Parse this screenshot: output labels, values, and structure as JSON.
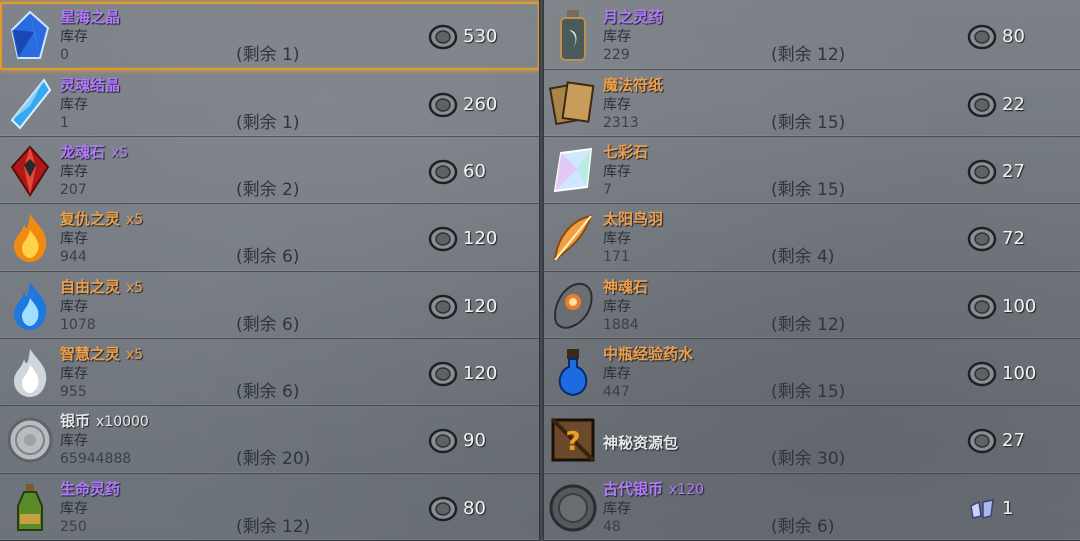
{
  "shop": {
    "labels": {
      "stock": "库存",
      "remain_prefix": "(剩余 ",
      "remain_suffix": ")"
    },
    "left_items": [
      {
        "name": "星海之晶",
        "qty": "",
        "color": "purple",
        "stock": "0",
        "remain": "(剩余 1)",
        "price": "530",
        "icon": "star-crystal-icon",
        "selected": true
      },
      {
        "name": "灵魂结晶",
        "qty": "",
        "color": "purple",
        "stock": "1",
        "remain": "(剩余 1)",
        "price": "260",
        "icon": "soul-crystal-icon",
        "selected": false
      },
      {
        "name": "龙魂石",
        "qty": "x5",
        "color": "purple",
        "stock": "207",
        "remain": "(剩余 2)",
        "price": "60",
        "icon": "dragon-soul-stone-icon",
        "selected": false
      },
      {
        "name": "复仇之灵",
        "qty": "x5",
        "color": "orange",
        "stock": "944",
        "remain": "(剩余 6)",
        "price": "120",
        "icon": "fire-spirit-icon",
        "selected": false
      },
      {
        "name": "自由之灵",
        "qty": "x5",
        "color": "orange",
        "stock": "1078",
        "remain": "(剩余 6)",
        "price": "120",
        "icon": "blue-spirit-icon",
        "selected": false
      },
      {
        "name": "智慧之灵",
        "qty": "x5",
        "color": "orange",
        "stock": "955",
        "remain": "(剩余 6)",
        "price": "120",
        "icon": "white-spirit-icon",
        "selected": false
      },
      {
        "name": "银币",
        "qty": "x10000",
        "color": "white",
        "stock": "65944888",
        "remain": "(剩余 20)",
        "price": "90",
        "icon": "silver-coin-icon",
        "selected": false
      },
      {
        "name": "生命灵药",
        "qty": "",
        "color": "purple",
        "stock": "250",
        "remain": "(剩余 12)",
        "price": "80",
        "icon": "life-potion-icon",
        "selected": false
      }
    ],
    "right_items": [
      {
        "name": "月之灵药",
        "qty": "",
        "color": "purple",
        "stock": "229",
        "remain": "(剩余 12)",
        "price": "80",
        "icon": "moon-potion-icon",
        "selected": false
      },
      {
        "name": "魔法符纸",
        "qty": "",
        "color": "orange",
        "stock": "2313",
        "remain": "(剩余 15)",
        "price": "22",
        "icon": "magic-paper-icon",
        "selected": false
      },
      {
        "name": "七彩石",
        "qty": "",
        "color": "orange",
        "stock": "7",
        "remain": "(剩余 15)",
        "price": "27",
        "icon": "rainbow-stone-icon",
        "selected": false
      },
      {
        "name": "太阳鸟羽",
        "qty": "",
        "color": "orange",
        "stock": "171",
        "remain": "(剩余 4)",
        "price": "72",
        "icon": "sunbird-feather-icon",
        "selected": false
      },
      {
        "name": "神魂石",
        "qty": "",
        "color": "orange",
        "stock": "1884",
        "remain": "(剩余 12)",
        "price": "100",
        "icon": "god-soul-stone-icon",
        "selected": false
      },
      {
        "name": "中瓶经验药水",
        "qty": "",
        "color": "orange",
        "stock": "447",
        "remain": "(剩余 15)",
        "price": "100",
        "icon": "exp-potion-icon",
        "selected": false
      },
      {
        "name": "神秘资源包",
        "qty": "",
        "color": "white",
        "stock": "",
        "remain": "(剩余 30)",
        "price": "27",
        "icon": "mystery-crate-icon",
        "selected": false,
        "no_stock": true
      },
      {
        "name": "古代银币",
        "qty": "x120",
        "color": "purple",
        "stock": "48",
        "remain": "(剩余 6)",
        "price": "1",
        "icon": "ancient-coin-icon",
        "selected": false,
        "price_icon": "wing-gem-icon"
      }
    ]
  },
  "colors": {
    "purple": "#b27bff",
    "orange": "#f0a04a",
    "white": "#e8e8e8",
    "selected_border": "#e29a2b"
  }
}
